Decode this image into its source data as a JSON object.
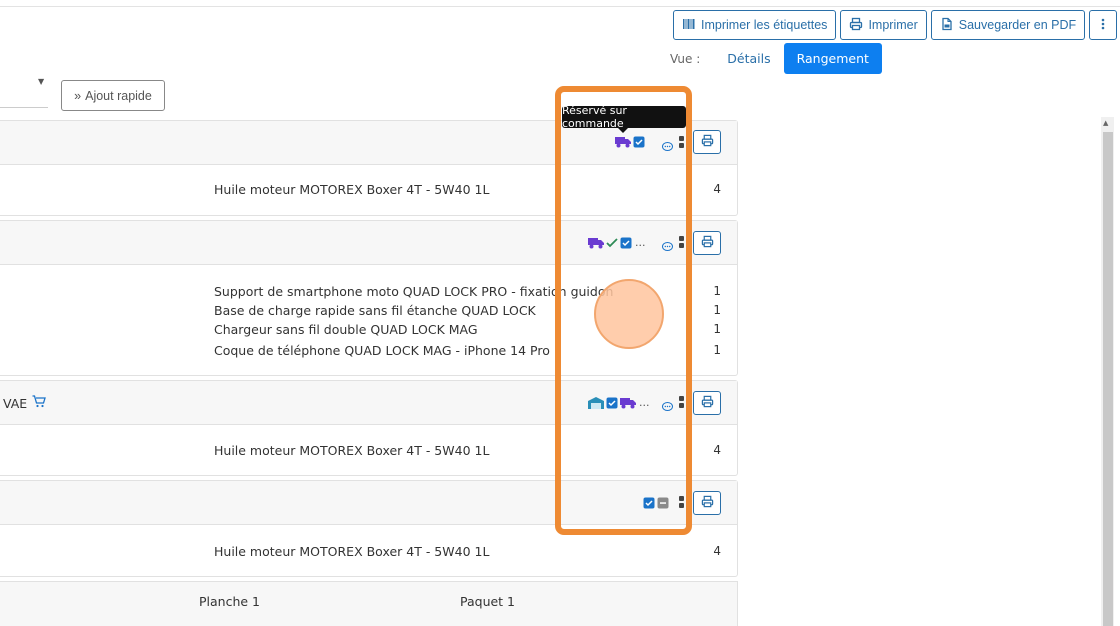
{
  "toolbar": {
    "print_labels": "Imprimer les étiquettes",
    "print": "Imprimer",
    "save_pdf": "Sauvegarder en PDF"
  },
  "view": {
    "label": "Vue :",
    "tabs": [
      {
        "label": "Détails",
        "active": false
      },
      {
        "label": "Rangement",
        "active": true
      }
    ]
  },
  "quick_add": "Ajout rapide",
  "tooltip": "Réservé sur commande",
  "orders": [
    {
      "products": [
        {
          "name": "Huile moteur MOTOREX Boxer 4T - 5W40 1L",
          "qty": "4"
        }
      ]
    },
    {
      "products": [
        {
          "name": "Support de smartphone moto QUAD LOCK PRO - fixation guidon",
          "qty": "1"
        },
        {
          "name": "Base de charge rapide sans fil étanche QUAD LOCK",
          "qty": "1"
        },
        {
          "name": "Chargeur sans fil double QUAD LOCK MAG",
          "qty": "1"
        },
        {
          "name": "Coque de téléphone QUAD LOCK MAG - iPhone 14 Pro",
          "qty": "1"
        }
      ],
      "more": "..."
    },
    {
      "head_label": "VAE",
      "products": [
        {
          "name": "Huile moteur MOTOREX Boxer 4T - 5W40 1L",
          "qty": "4"
        }
      ],
      "more": "..."
    },
    {
      "products": [
        {
          "name": "Huile moteur MOTOREX Boxer 4T - 5W40 1L",
          "qty": "4"
        }
      ]
    }
  ],
  "footer": {
    "col1": "Planche 1",
    "col2": "Paquet 1"
  },
  "colors": {
    "accent": "#0d7ff0",
    "highlight": "#ee8a33",
    "truck": "#6a3bd1",
    "check": "#2e8b57"
  }
}
